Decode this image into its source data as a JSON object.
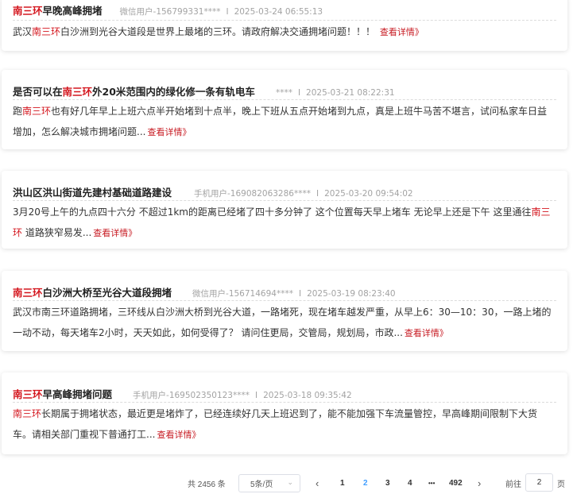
{
  "posts": [
    {
      "title_hl": "南三环",
      "title_rest": "早晚高峰拥堵",
      "user": "微信用户-156799331****",
      "date": "2025-03-24 06:55:13",
      "body_pre": "武汉",
      "body_hl": "南三环",
      "body_post": "白沙洲到光谷大道段是世界上最堵的三环。请政府解决交通拥堵问题！！！ ",
      "more": "查看详情》"
    },
    {
      "title_pre": "是否可以在",
      "title_hl": "南三环",
      "title_rest": "外20米范围内的绿化修一条有轨电车",
      "user": "****",
      "date": "2025-03-21 08:22:31",
      "body_pre": "跑",
      "body_hl": "南三环",
      "body_post": "也有好几年早上上班六点半开始堵到十点半，晚上下班从五点开始堵到九点，真是上班牛马苦不堪言，试问私家车日益增加，怎么解决城市拥堵问题...",
      "more": "查看详情》"
    },
    {
      "title_rest": "洪山区洪山街道先建村基础道路建设",
      "user": "手机用户-169082063286****",
      "date": "2025-03-20 09:54:02",
      "body_pre": "3月20号上午的九点四十六分 不超过1km的距离已经堵了四十多分钟了 这个位置每天早上堵车 无论早上还是下午 这里通往",
      "body_hl": "南三环",
      "body_post": " 道路狭窄易发...",
      "more": "查看详情》"
    },
    {
      "title_hl": "南三环",
      "title_rest": "白沙洲大桥至光谷大道段拥堵",
      "user": "微信用户-156714694****",
      "date": "2025-03-19 08:23:40",
      "body_pre": "武汉市南三环道路拥堵，三环线从白沙洲大桥到光谷大道，一路堵死，现在堵车越发严重，从早上6：30—10：30，一路上堵的一动不动，每天堵车2小时，天天如此，如何受得了？ 请问住更局，交管局，规划局，市政...",
      "more": "查看详情》"
    },
    {
      "title_hl": "南三环",
      "title_rest": "早高峰拥堵问题",
      "user": "手机用户-169502350123****",
      "date": "2025-03-18 09:35:42",
      "body_hl": "南三环",
      "body_post": "长期属于拥堵状态，最近更是堵炸了，已经连续好几天上班迟到了，能不能加强下车流量管控，早高峰期间限制下大货车。请相关部门重视下普通打工...",
      "more": "查看详情》"
    }
  ],
  "meta_separator": "I",
  "pagination": {
    "total_text": "共 2456 条",
    "page_size": "5条/页",
    "prev": "‹",
    "next": "›",
    "pages": [
      "1",
      "2",
      "3",
      "4",
      "•••",
      "492"
    ],
    "active_page": "2",
    "goto_label": "前往",
    "goto_value": "2",
    "goto_unit": "页"
  }
}
